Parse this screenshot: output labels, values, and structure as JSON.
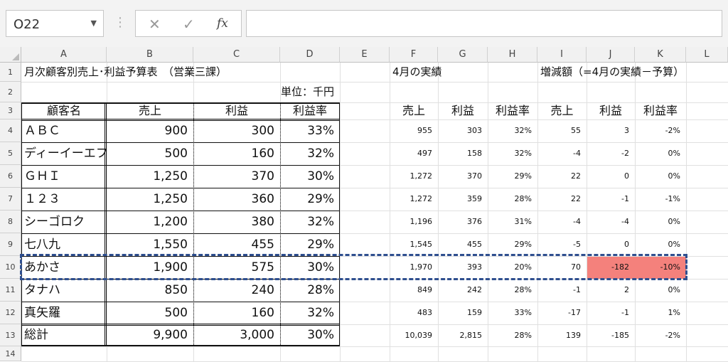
{
  "name_box": {
    "value": "O22"
  },
  "formula_bar": {
    "cancel_icon": "✕",
    "enter_icon": "✓",
    "fx_label": "fx",
    "value": ""
  },
  "columns": [
    "A",
    "B",
    "C",
    "D",
    "E",
    "F",
    "G",
    "H",
    "I",
    "J",
    "K",
    "L"
  ],
  "rows": [
    "1",
    "2",
    "3",
    "4",
    "5",
    "6",
    "7",
    "8",
    "9",
    "10",
    "11",
    "12",
    "13",
    "14"
  ],
  "sheet": {
    "title": "月次顧客別売上･利益予算表　（営業三課）",
    "actual_title": "4月の実績",
    "diff_title": "増減額（=4月の実績－予算）",
    "unit": "単位：千円",
    "headers_budget": [
      "顧客名",
      "売上",
      "利益",
      "利益率"
    ],
    "headers_actual": [
      "売上",
      "利益",
      "利益率"
    ],
    "headers_diff": [
      "売上",
      "利益",
      "利益率"
    ],
    "data_rows": [
      {
        "name": "ＡＢＣ",
        "sales": "900",
        "profit": "300",
        "rate": "33%",
        "a_sales": "955",
        "a_profit": "303",
        "a_rate": "32%",
        "d_sales": "55",
        "d_profit": "3",
        "d_rate": "-2%"
      },
      {
        "name": "ディーイーエフ",
        "sales": "500",
        "profit": "160",
        "rate": "32%",
        "a_sales": "497",
        "a_profit": "158",
        "a_rate": "32%",
        "d_sales": "-4",
        "d_profit": "-2",
        "d_rate": "0%"
      },
      {
        "name": "ＧＨＩ",
        "sales": "1,250",
        "profit": "370",
        "rate": "30%",
        "a_sales": "1,272",
        "a_profit": "370",
        "a_rate": "29%",
        "d_sales": "22",
        "d_profit": "0",
        "d_rate": "0%"
      },
      {
        "name": "１２３",
        "sales": "1,250",
        "profit": "360",
        "rate": "29%",
        "a_sales": "1,272",
        "a_profit": "359",
        "a_rate": "28%",
        "d_sales": "22",
        "d_profit": "-1",
        "d_rate": "-1%"
      },
      {
        "name": "シーゴロク",
        "sales": "1,200",
        "profit": "380",
        "rate": "32%",
        "a_sales": "1,196",
        "a_profit": "376",
        "a_rate": "31%",
        "d_sales": "-4",
        "d_profit": "-4",
        "d_rate": "0%"
      },
      {
        "name": "七八九",
        "sales": "1,550",
        "profit": "455",
        "rate": "29%",
        "a_sales": "1,545",
        "a_profit": "455",
        "a_rate": "29%",
        "d_sales": "-5",
        "d_profit": "0",
        "d_rate": "0%"
      },
      {
        "name": "あかさ",
        "sales": "1,900",
        "profit": "575",
        "rate": "30%",
        "a_sales": "1,970",
        "a_profit": "393",
        "a_rate": "20%",
        "d_sales": "70",
        "d_profit": "-182",
        "d_rate": "-10%"
      },
      {
        "name": "タナハ",
        "sales": "850",
        "profit": "240",
        "rate": "28%",
        "a_sales": "849",
        "a_profit": "242",
        "a_rate": "28%",
        "d_sales": "-1",
        "d_profit": "2",
        "d_rate": "0%"
      },
      {
        "name": "真矢羅",
        "sales": "500",
        "profit": "160",
        "rate": "32%",
        "a_sales": "483",
        "a_profit": "159",
        "a_rate": "33%",
        "d_sales": "-17",
        "d_profit": "-1",
        "d_rate": "1%"
      },
      {
        "name": "総計",
        "sales": "9,900",
        "profit": "3,000",
        "rate": "30%",
        "a_sales": "10,039",
        "a_profit": "2,815",
        "a_rate": "28%",
        "d_sales": "139",
        "d_profit": "-185",
        "d_rate": "-2%"
      }
    ]
  },
  "highlight_color": "#f4817c",
  "selection_color": "#2f4f8f"
}
